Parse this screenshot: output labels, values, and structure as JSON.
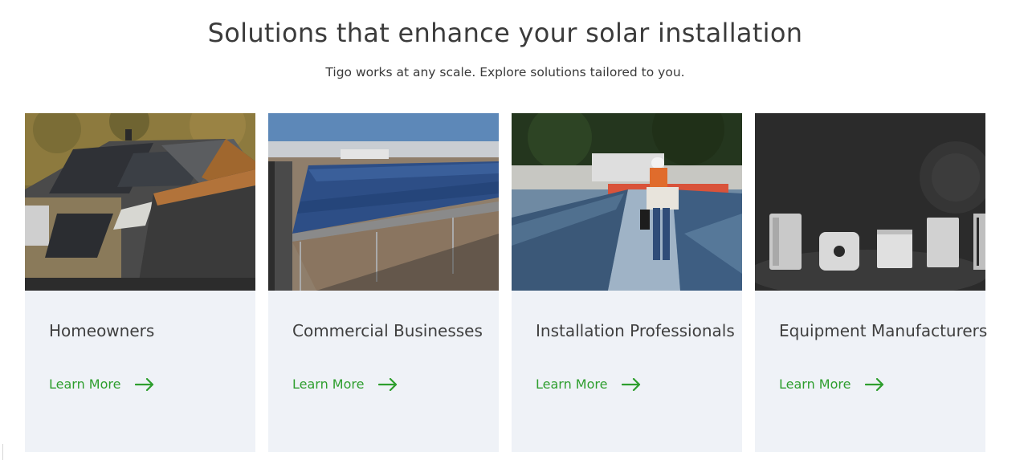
{
  "section": {
    "title": "Solutions that enhance your solar installation",
    "subtitle": "Tigo works at any scale. Explore solutions tailored to you."
  },
  "cards": [
    {
      "title": "Homeowners",
      "link_label": "Learn More",
      "image": "residential-roof-solar-photo"
    },
    {
      "title": "Commercial Businesses",
      "link_label": "Learn More",
      "image": "commercial-carport-solar-photo"
    },
    {
      "title": "Installation Professionals",
      "link_label": "Learn More",
      "image": "installer-on-roof-photo"
    },
    {
      "title": "Equipment Manufacturers",
      "link_label": "Learn More",
      "image": "inverter-equipment-photo"
    }
  ],
  "colors": {
    "accent": "#2e9e2e",
    "card_bg": "#eff2f7",
    "text": "#3f3f3f"
  }
}
